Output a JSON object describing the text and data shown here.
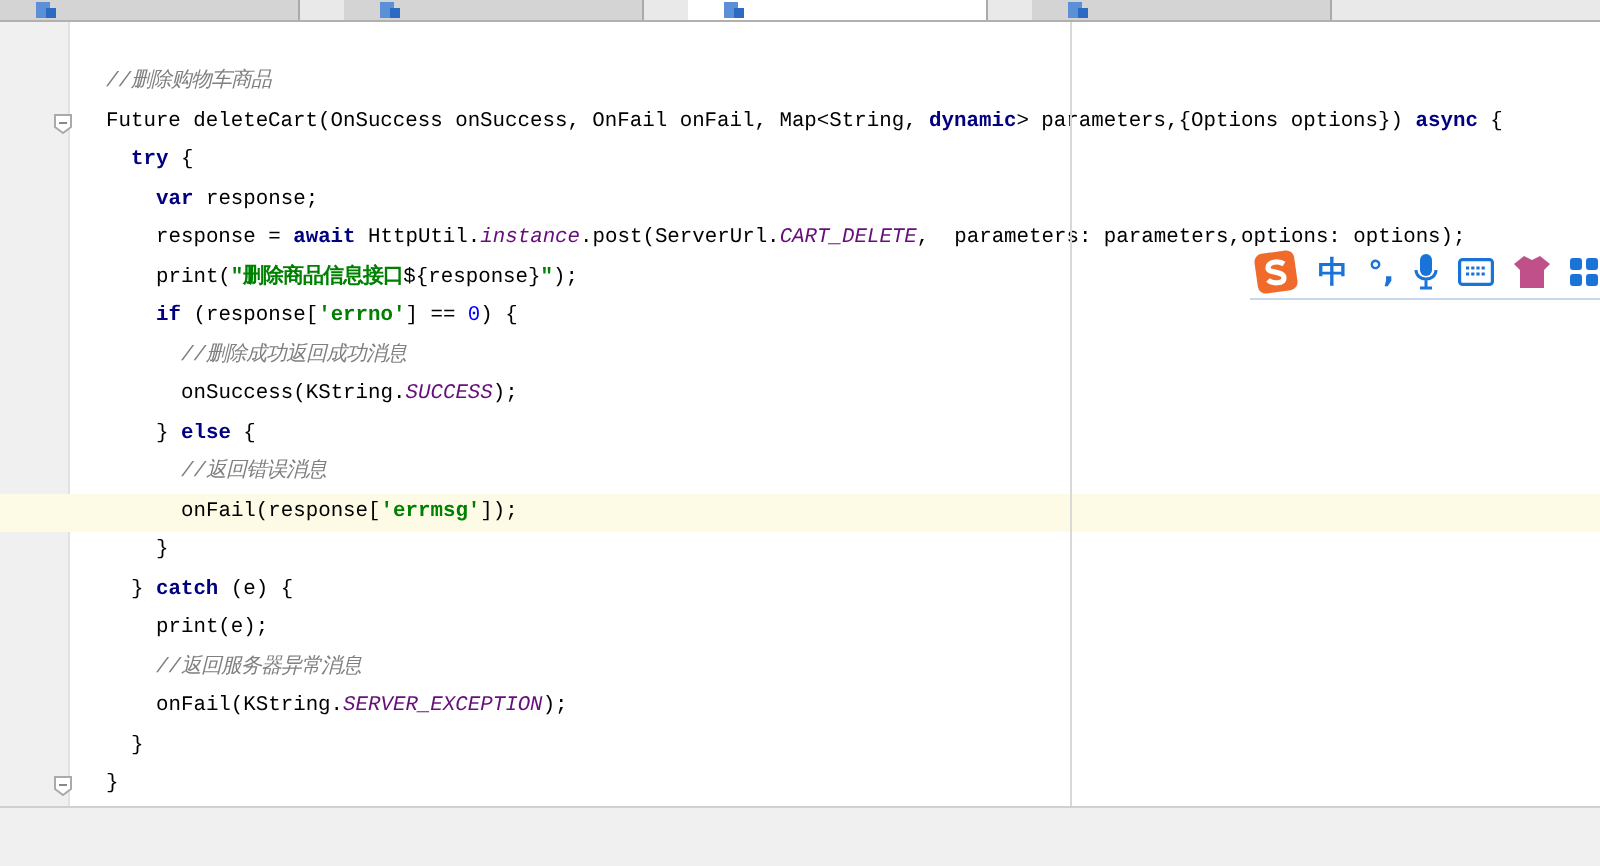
{
  "tabs": [
    {
      "selected": false
    },
    {
      "selected": false
    },
    {
      "selected": true
    },
    {
      "selected": false
    }
  ],
  "code": [
    {
      "tokens": [
        {
          "kind": "comment",
          "text": "//删除购物车商品"
        }
      ]
    },
    {
      "fold": true,
      "tokens": [
        {
          "kind": "plain",
          "text": "Future deleteCart(OnSuccess onSuccess, OnFail onFail, Map<String, "
        },
        {
          "kind": "keyword",
          "text": "dynamic"
        },
        {
          "kind": "plain",
          "text": "> parameters,{Options options}) "
        },
        {
          "kind": "keyword",
          "text": "async"
        },
        {
          "kind": "plain",
          "text": " {"
        }
      ],
      "children": [
        {
          "tokens": [
            {
              "kind": "keyword",
              "text": "try"
            },
            {
              "kind": "plain",
              "text": " {"
            }
          ],
          "children": [
            {
              "tokens": [
                {
                  "kind": "keyword",
                  "text": "var"
                },
                {
                  "kind": "plain",
                  "text": " response;"
                }
              ]
            },
            {
              "tokens": [
                {
                  "kind": "plain",
                  "text": "response = "
                },
                {
                  "kind": "keyword",
                  "text": "await"
                },
                {
                  "kind": "plain",
                  "text": " HttpUtil."
                },
                {
                  "kind": "static",
                  "text": "instance"
                },
                {
                  "kind": "plain",
                  "text": ".post(ServerUrl."
                },
                {
                  "kind": "static",
                  "text": "CART_DELETE"
                },
                {
                  "kind": "plain",
                  "text": ",  parameters: parameters,options: options);"
                }
              ]
            },
            {
              "tokens": [
                {
                  "kind": "plain",
                  "text": "print("
                },
                {
                  "kind": "string",
                  "text": "\"删除商品信息接口"
                },
                {
                  "kind": "plain",
                  "text": "${response}"
                },
                {
                  "kind": "string",
                  "text": "\""
                },
                {
                  "kind": "plain",
                  "text": ");"
                }
              ]
            },
            {
              "tokens": [
                {
                  "kind": "keyword",
                  "text": "if"
                },
                {
                  "kind": "plain",
                  "text": " (response["
                },
                {
                  "kind": "string",
                  "text": "'errno'"
                },
                {
                  "kind": "plain",
                  "text": "] == "
                },
                {
                  "kind": "number",
                  "text": "0"
                },
                {
                  "kind": "plain",
                  "text": ") {"
                }
              ],
              "children": [
                {
                  "tokens": [
                    {
                      "kind": "comment",
                      "text": "//删除成功返回成功消息"
                    }
                  ]
                },
                {
                  "tokens": [
                    {
                      "kind": "plain",
                      "text": "onSuccess(KString."
                    },
                    {
                      "kind": "static",
                      "text": "SUCCESS"
                    },
                    {
                      "kind": "plain",
                      "text": ");"
                    }
                  ]
                }
              ]
            },
            {
              "tokens": [
                {
                  "kind": "plain",
                  "text": "} "
                },
                {
                  "kind": "keyword",
                  "text": "else"
                },
                {
                  "kind": "plain",
                  "text": " {"
                }
              ],
              "children": [
                {
                  "tokens": [
                    {
                      "kind": "comment",
                      "text": "//返回错误消息"
                    }
                  ]
                },
                {
                  "highlighted": true,
                  "tokens": [
                    {
                      "kind": "plain",
                      "text": "onFail(response["
                    },
                    {
                      "kind": "string",
                      "text": "'errmsg'"
                    },
                    {
                      "kind": "plain",
                      "text": "]);"
                    }
                  ]
                }
              ]
            },
            {
              "tokens": [
                {
                  "kind": "plain",
                  "text": "}"
                }
              ]
            }
          ]
        },
        {
          "tokens": [
            {
              "kind": "plain",
              "text": "} "
            },
            {
              "kind": "keyword",
              "text": "catch"
            },
            {
              "kind": "plain",
              "text": " (e) {"
            }
          ],
          "children": [
            {
              "tokens": [
                {
                  "kind": "plain",
                  "text": "print(e);"
                }
              ]
            },
            {
              "tokens": [
                {
                  "kind": "comment",
                  "text": "//返回服务器异常消息"
                }
              ]
            },
            {
              "tokens": [
                {
                  "kind": "plain",
                  "text": "onFail(KString."
                },
                {
                  "kind": "static",
                  "text": "SERVER_EXCEPTION"
                },
                {
                  "kind": "plain",
                  "text": ");"
                }
              ]
            }
          ]
        },
        {
          "tokens": [
            {
              "kind": "plain",
              "text": "}"
            }
          ]
        }
      ]
    },
    {
      "fold": true,
      "tokens": [
        {
          "kind": "plain",
          "text": "}"
        }
      ]
    }
  ],
  "ime_toolbar": {
    "items": [
      {
        "kind": "logo"
      },
      {
        "kind": "text",
        "text": "中"
      },
      {
        "kind": "text",
        "text": "°,"
      },
      {
        "kind": "mic"
      },
      {
        "kind": "keyboard"
      },
      {
        "kind": "shirt"
      },
      {
        "kind": "grid"
      }
    ]
  }
}
